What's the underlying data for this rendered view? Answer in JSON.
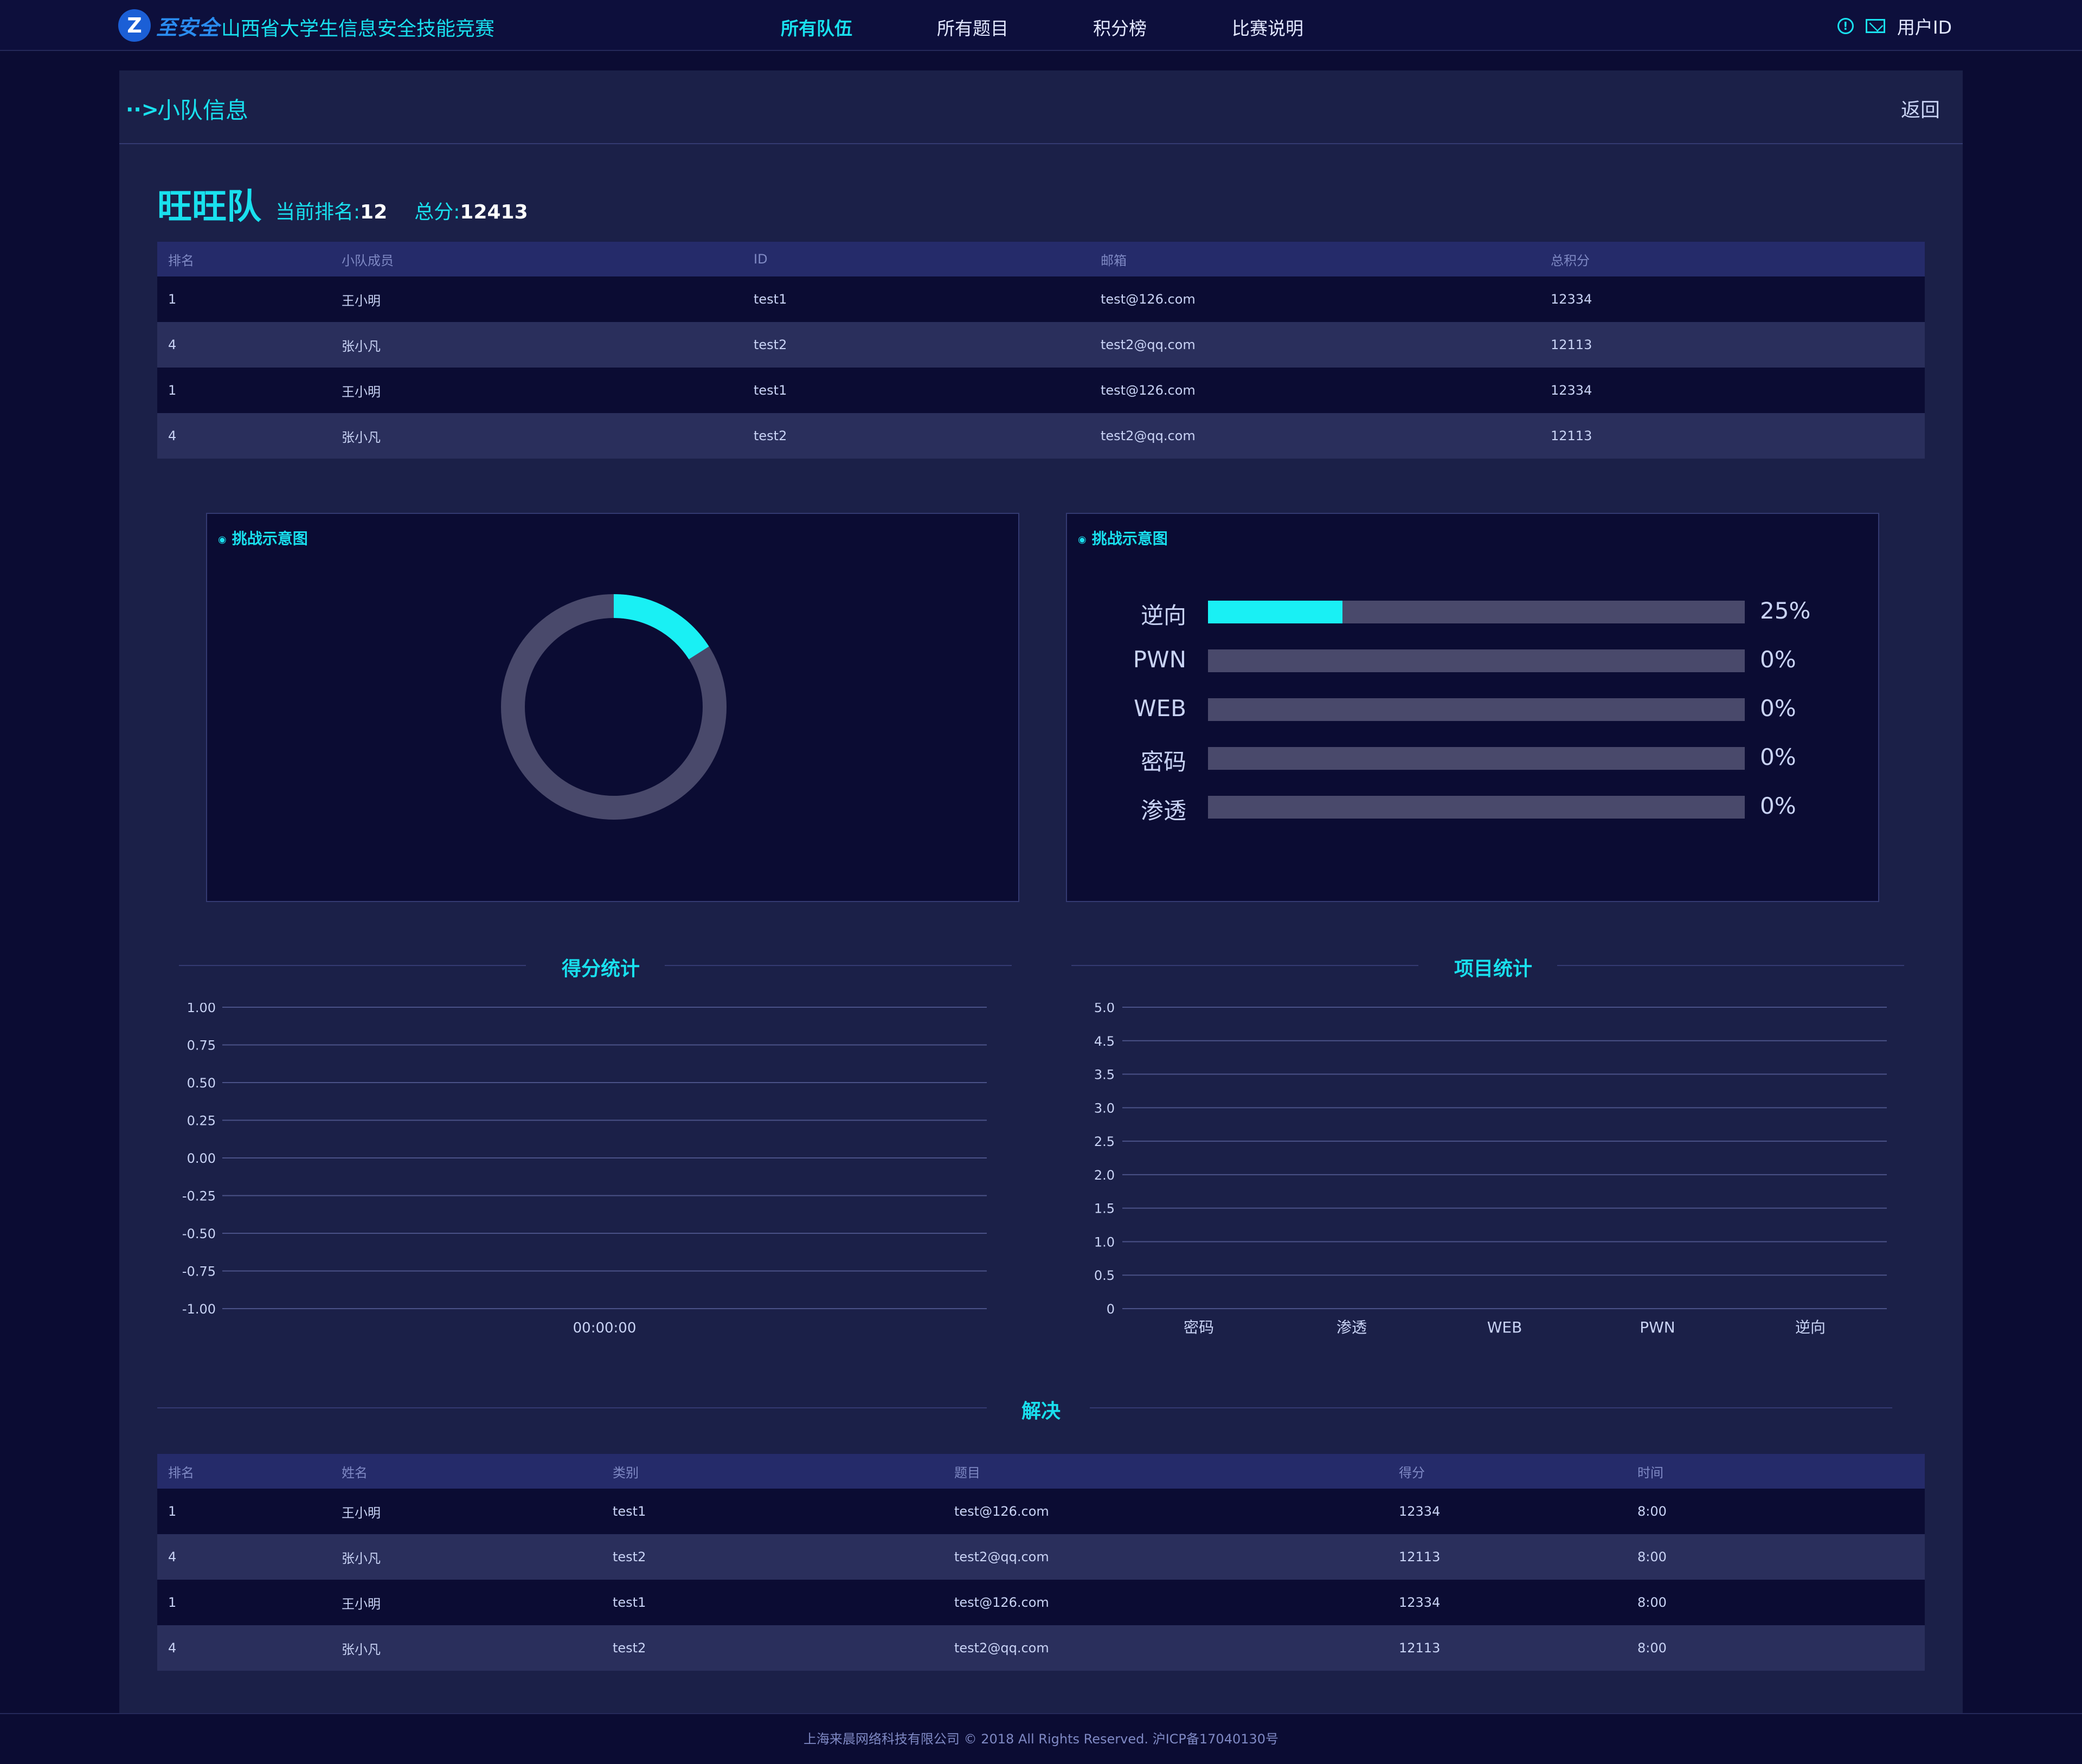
{
  "header": {
    "logo_text": "至安全",
    "site_title": "山西省大学生信息安全技能竞赛",
    "nav": [
      "所有队伍",
      "所有题目",
      "积分榜",
      "比赛说明"
    ],
    "user_label": "用户ID"
  },
  "panel": {
    "title": "小队信息",
    "back_label": "返回"
  },
  "team": {
    "name": "旺旺队",
    "rank_label": "当前排名:",
    "rank_value": "12",
    "score_label": "总分:",
    "score_value": "12413"
  },
  "members_table": {
    "headers": [
      "排名",
      "小队成员",
      "ID",
      "邮箱",
      "总积分"
    ],
    "rows": [
      [
        "1",
        "王小明",
        "test1",
        "test@126.com",
        "12334"
      ],
      [
        "4",
        "张小凡",
        "test2",
        "test2@qq.com",
        "12113"
      ],
      [
        "1",
        "王小明",
        "test1",
        "test@126.com",
        "12334"
      ],
      [
        "4",
        "张小凡",
        "test2",
        "test2@qq.com",
        "12113"
      ]
    ]
  },
  "charts": {
    "donut_title": "挑战示意图",
    "bars_title": "挑战示意图",
    "score_section": "得分统计",
    "project_section": "项目统计",
    "solve_section": "解决"
  },
  "colors": {
    "accent": "#19e0ee",
    "bar_fill": "#19f0f4",
    "track": "#49496b",
    "bg": "#0b0c33",
    "panel": "#1b2048"
  },
  "chart_data": [
    {
      "type": "pie",
      "title": "挑战示意图",
      "values": [
        0.16,
        0.84
      ],
      "style": "donut"
    },
    {
      "type": "bar",
      "title": "挑战示意图",
      "orientation": "horizontal",
      "categories": [
        "逆向",
        "PWN",
        "WEB",
        "密码",
        "渗透"
      ],
      "values": [
        25,
        0,
        0,
        0,
        0
      ],
      "labels": [
        "25%",
        "0%",
        "0%",
        "0%",
        "0%"
      ],
      "xlim": [
        0,
        100
      ]
    },
    {
      "type": "line",
      "title": "得分统计",
      "x": [
        "00:00:00"
      ],
      "yticks": [
        "1.00",
        "0.75",
        "0.50",
        "0.25",
        "0.00",
        "-0.25",
        "-0.50",
        "-0.75",
        "-1.00"
      ],
      "ylim": [
        -1,
        1
      ],
      "grid": true,
      "series": []
    },
    {
      "type": "bar",
      "title": "项目统计",
      "categories": [
        "密码",
        "渗透",
        "WEB",
        "PWN",
        "逆向"
      ],
      "values": [
        0,
        0,
        0,
        0,
        0
      ],
      "yticks": [
        "5.0",
        "4.5",
        "3.5",
        "3.0",
        "2.5",
        "2.0",
        "1.5",
        "1.0",
        "0.5",
        "0"
      ],
      "ylim": [
        0,
        5
      ],
      "grid": true
    }
  ],
  "solves_table": {
    "headers": [
      "排名",
      "姓名",
      "类别",
      "题目",
      "得分",
      "时间"
    ],
    "rows": [
      [
        "1",
        "王小明",
        "test1",
        "test@126.com",
        "12334",
        "8:00"
      ],
      [
        "4",
        "张小凡",
        "test2",
        "test2@qq.com",
        "12113",
        "8:00"
      ],
      [
        "1",
        "王小明",
        "test1",
        "test@126.com",
        "12334",
        "8:00"
      ],
      [
        "4",
        "张小凡",
        "test2",
        "test2@qq.com",
        "12113",
        "8:00"
      ]
    ]
  },
  "footer": {
    "text": "上海来晨网络科技有限公司 © 2018 All Rights Reserved.  沪ICP备17040130号"
  }
}
